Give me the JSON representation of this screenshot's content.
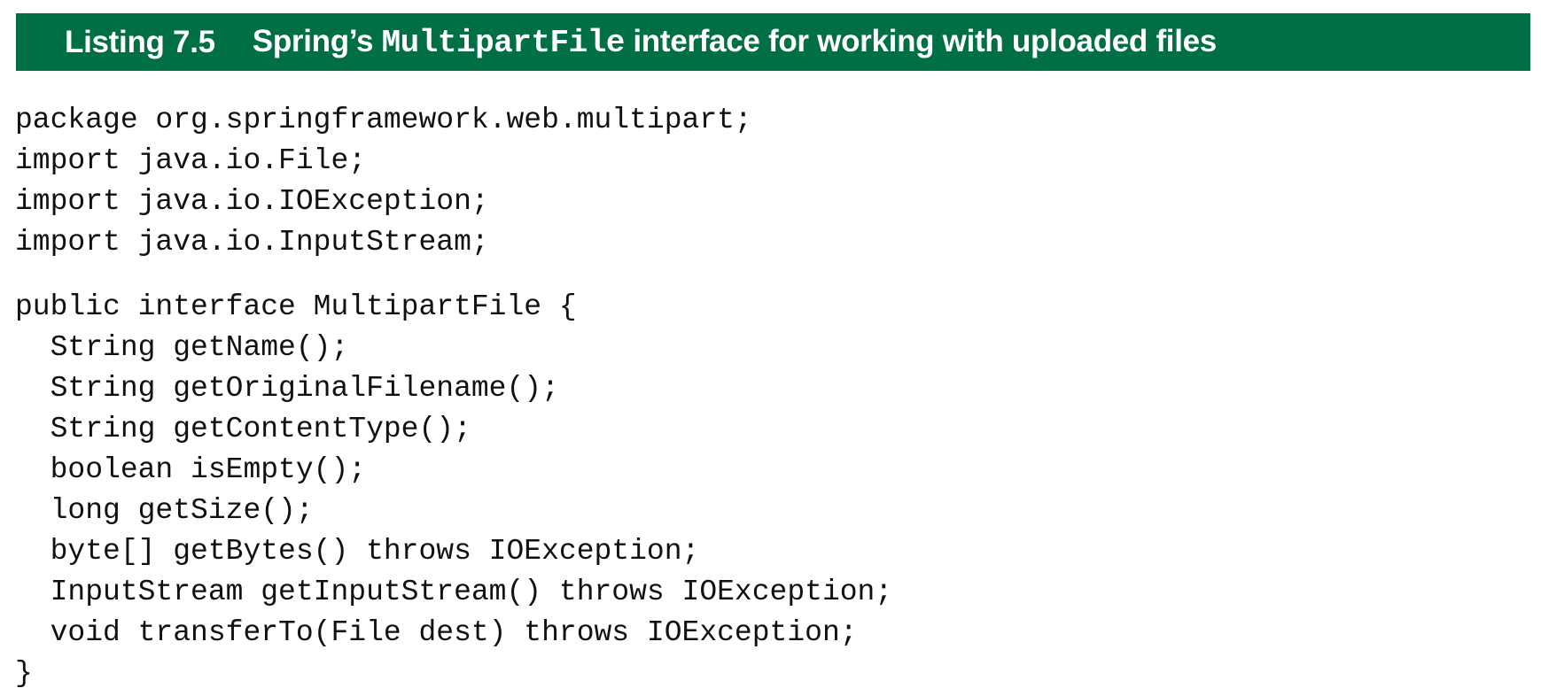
{
  "header": {
    "listing_number": "Listing 7.5",
    "title_prefix": "Spring’s",
    "title_code": "MultipartFile",
    "title_suffix": "interface for working with uploaded files"
  },
  "code": {
    "imports": [
      "package org.springframework.web.multipart;",
      "import java.io.File;",
      "import java.io.IOException;",
      "import java.io.InputStream;"
    ],
    "body": [
      "public interface MultipartFile {",
      "  String getName();",
      "  String getOriginalFilename();",
      "  String getContentType();",
      "  boolean isEmpty();",
      "  long getSize();",
      "  byte[] getBytes() throws IOException;",
      "  InputStream getInputStream() throws IOException;",
      "  void transferTo(File dest) throws IOException;",
      "}"
    ]
  },
  "colors": {
    "header_background": "#006f46",
    "header_text": "#ffffff",
    "code_text": "#111111"
  }
}
